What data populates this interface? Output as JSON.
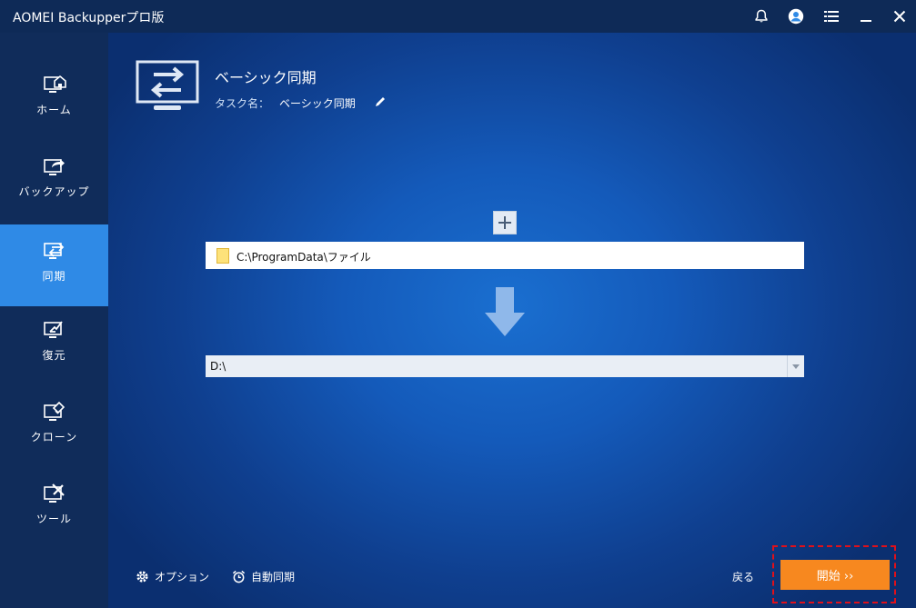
{
  "app": {
    "title": "AOMEI Backupperプロ版"
  },
  "sidebar": {
    "items": [
      {
        "label": "ホーム",
        "icon": "home-icon"
      },
      {
        "label": "バックアップ",
        "icon": "backup-icon"
      },
      {
        "label": "同期",
        "icon": "sync-icon",
        "active": true
      },
      {
        "label": "復元",
        "icon": "restore-icon"
      },
      {
        "label": "クローン",
        "icon": "clone-icon"
      },
      {
        "label": "ツール",
        "icon": "tools-icon"
      }
    ]
  },
  "header": {
    "operation_title": "ベーシック同期",
    "task_label": "タスク名：",
    "task_name": "ベーシック同期"
  },
  "source": {
    "path": "C:\\ProgramData\\ファイル"
  },
  "destination": {
    "path": "D:\\"
  },
  "footer": {
    "options_label": "オプション",
    "schedule_label": "自動同期",
    "back_label": "戻る",
    "start_label": "開始 ››"
  },
  "colors": {
    "accent": "#2f8ae6",
    "start": "#f7881f",
    "highlight": "#e0101a"
  }
}
